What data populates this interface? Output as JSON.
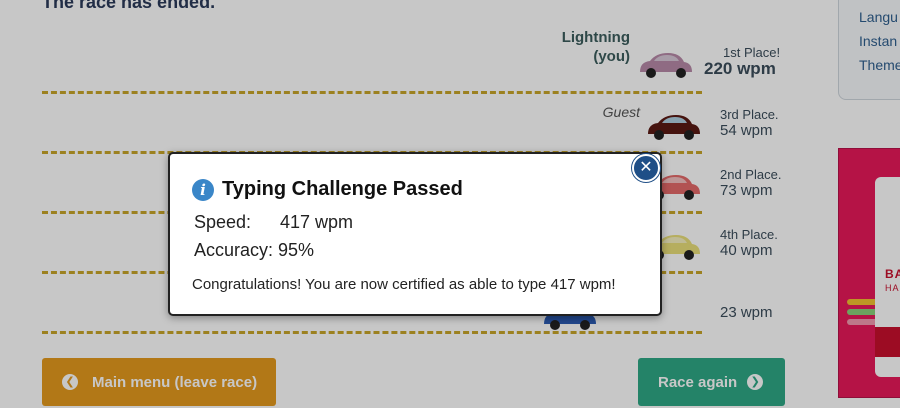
{
  "race": {
    "status": "The race has ended.",
    "lanes": [
      {
        "name_line1": "Lightning",
        "name_line2": "(you)",
        "place": "1st Place!",
        "wpm": "220 wpm",
        "car_color": "#b889a8"
      },
      {
        "name_line1": "Guest",
        "place": "3rd Place.",
        "wpm": "54 wpm",
        "car_color": "#5a1a14"
      },
      {
        "place": "2nd Place.",
        "wpm": "73 wpm",
        "car_color": "#e46a6a"
      },
      {
        "place": "4th Place.",
        "wpm": "40 wpm",
        "car_color": "#e9df7a"
      },
      {
        "place": "",
        "wpm": "23 wpm",
        "car_color": "#2c5db5"
      }
    ]
  },
  "sidebar": {
    "links": [
      "Langu",
      "Instan",
      "Theme"
    ]
  },
  "ad": {
    "text": "BAR",
    "subtext": "HARD"
  },
  "buttons": {
    "main_menu": "Main menu (leave race)",
    "race_again": "Race again"
  },
  "modal": {
    "title": "Typing Challenge Passed",
    "speed_label": "Speed:",
    "speed_value": "417 wpm",
    "accuracy_label": "Accuracy:",
    "accuracy_value": "95%",
    "message": "Congratulations! You are now certified as able to type 417 wpm!",
    "close_symbol": "✕"
  },
  "colors": {
    "track_dash": "#c8a62a",
    "main_button": "#e59a1e",
    "again_button": "#2fa886",
    "close_button": "#1f4f87",
    "info_icon": "#3a86c8"
  }
}
